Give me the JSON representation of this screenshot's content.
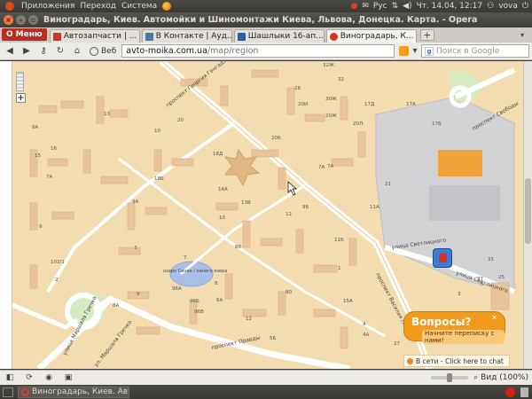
{
  "topbar": {
    "menu": [
      "Приложения",
      "Переход",
      "Система"
    ],
    "keyboard": "Рус",
    "datetime": "Чт. 14.04, 12:17",
    "user": "vova"
  },
  "window": {
    "title": "Виноградарь, Киев. Автомойки и Шиномонтажи Киева, Львова, Донецка. Карта. - Opera"
  },
  "tabbar": {
    "menu_label": "Меню",
    "tabs": [
      {
        "label": "Автозапчасти | ...",
        "color": "#c0392b"
      },
      {
        "label": "В Контакте | Ауд...",
        "color": "#4a76a8"
      },
      {
        "label": "Шашлыки 16-ап...",
        "color": "#2e5aa8"
      },
      {
        "label": "Виноградарь, К...",
        "color": "#d9351d"
      }
    ],
    "new_tab": "+"
  },
  "navbar": {
    "web_label": "Веб",
    "url_domain": "avto-moika.com.ua",
    "url_path": "/map/region",
    "search_placeholder": "Поиск в Google"
  },
  "map": {
    "streets": [
      "проспект Георгия Гонгадзе",
      "проспект Свободы",
      "улица Светлицкого",
      "улица Светлицкого",
      "проспект Василия Порика",
      "улица Маршала Гречко",
      "проспект Правды",
      "ул. Маршала Гречко"
    ],
    "lake_label": "озеро Синее / синего озера",
    "buildings": [
      "32Ж",
      "32",
      "28",
      "30Ж",
      "20И",
      "17Д",
      "20Ж",
      "20Л",
      "9А",
      "13",
      "20",
      "20Б",
      "10",
      "16",
      "18Д",
      "18Б",
      "7А",
      "15",
      "14А",
      "13В",
      "12",
      "9А",
      "9Б",
      "11А",
      "3",
      "7",
      "10",
      "88",
      "11Б",
      "1",
      "2",
      "102/1",
      "8А",
      "9",
      "96А",
      "96Б",
      "8",
      "96В",
      "80",
      "15А",
      "6А",
      "12",
      "7А",
      "5",
      "7А",
      "3",
      "37",
      "25",
      "35",
      "17А",
      "17Б",
      "4",
      "4А",
      "5Б",
      "21",
      "27",
      "9"
    ]
  },
  "chat": {
    "title": "Вопросы?",
    "subtitle": "Начните переписку с нами!",
    "status": "В сети - Click here to chat",
    "close": "✕"
  },
  "statusbar": {
    "zoom_label": "Вид (100%)"
  },
  "taskbar": {
    "item": "Виноградарь, Киев. Авт..."
  }
}
